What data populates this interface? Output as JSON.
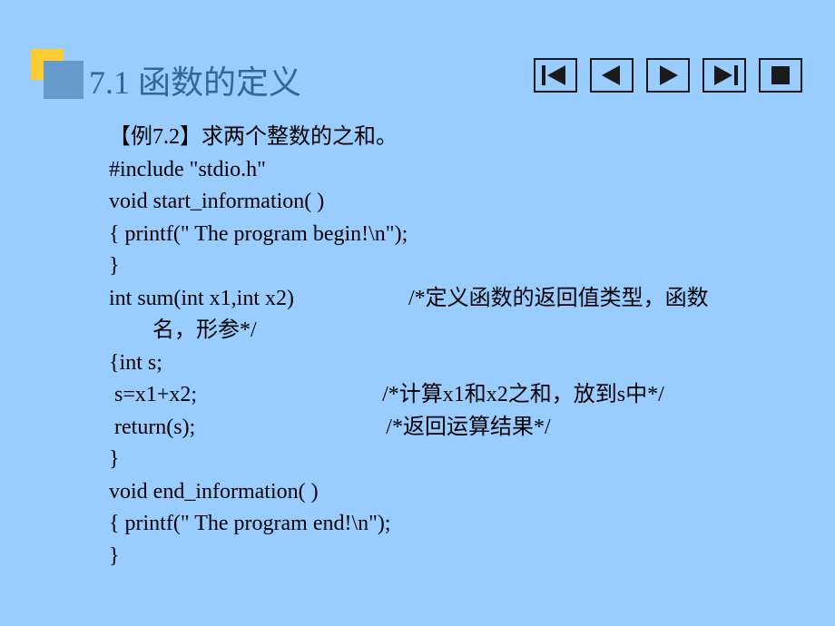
{
  "title": "7.1 函数的定义",
  "nav": {
    "first": "first-button",
    "prev": "prev-button",
    "next": "next-button",
    "last": "last-button",
    "stop": "stop-button"
  },
  "content": {
    "l1": "【例7.2】求两个整数的之和。",
    "l2": "#include \"stdio.h\"",
    "l3": "void start_information( )",
    "l4": "{ printf(\" The program begin!\\n\");",
    "l5": "}",
    "l6": "int sum(int x1,int x2)                     /*定义函数的返回值类型，函数",
    "l6b": "名，形参*/",
    "l7": "{int s;",
    "l8": " s=x1+x2;                                  /*计算x1和x2之和，放到s中*/",
    "l9": " return(s);                                   /*返回运算结果*/",
    "l10": "}",
    "l11": "void end_information( )",
    "l12": "{ printf(\" The program end!\\n\");",
    "l13": "}"
  }
}
